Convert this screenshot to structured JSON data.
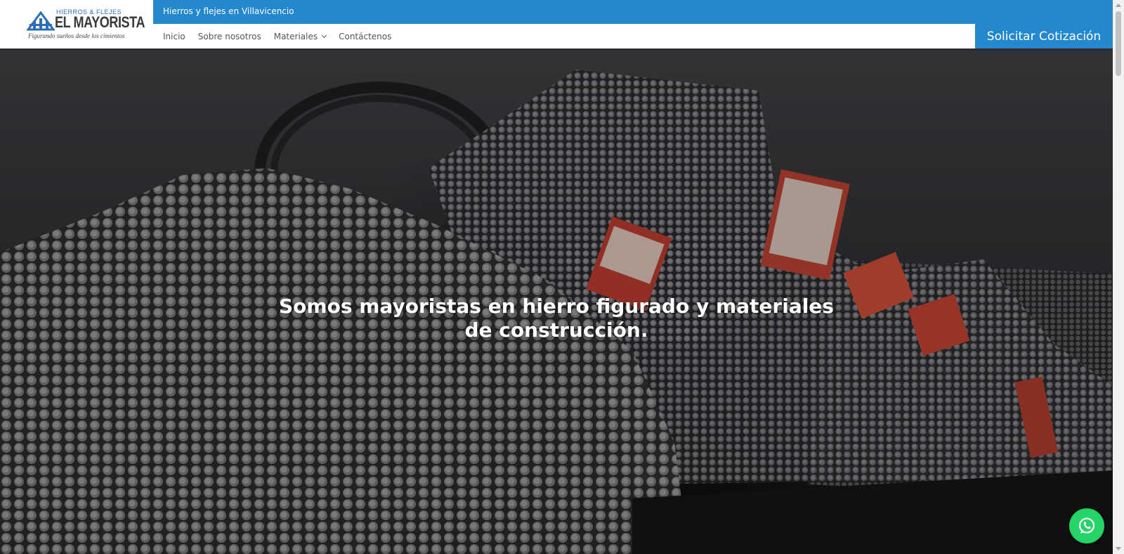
{
  "logo": {
    "line1": "HIERROS & FLEJES",
    "line2": "EL MAYORISTA",
    "tagline": "Figurando sueños desde los cimientos"
  },
  "topbar": {
    "text": "Hierros y flejes en Villavicencio"
  },
  "nav": {
    "items": [
      {
        "label": "Inicio"
      },
      {
        "label": "Sobre nosotros"
      },
      {
        "label": "Materiales"
      },
      {
        "label": "Contáctenos"
      }
    ]
  },
  "cta": {
    "label": "Solicitar Cotización"
  },
  "hero": {
    "title": "Somos mayoristas en hierro figurado y materiales de construcción."
  },
  "colors": {
    "brand_blue": "#2488cf",
    "whatsapp_green": "#25d366",
    "header_bg": "#ffffff"
  },
  "icons": {
    "whatsapp": "whatsapp-icon",
    "dropdown": "chevron-down-icon"
  }
}
